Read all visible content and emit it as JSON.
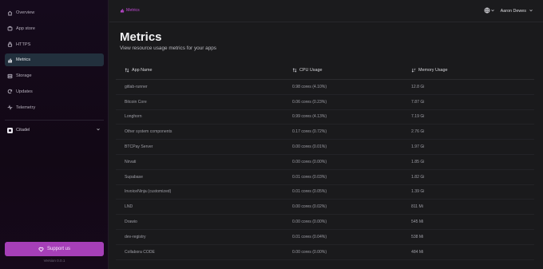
{
  "sidebar": {
    "items": [
      {
        "label": "Overview",
        "icon": "home-icon"
      },
      {
        "label": "App store",
        "icon": "store-icon"
      },
      {
        "label": "HTTPS",
        "icon": "lock-icon"
      },
      {
        "label": "Metrics",
        "icon": "bar-chart-icon",
        "active": true
      },
      {
        "label": "Storage",
        "icon": "storage-icon"
      },
      {
        "label": "Updates",
        "icon": "refresh-icon"
      },
      {
        "label": "Telemetry",
        "icon": "activity-icon"
      }
    ],
    "citadel": {
      "label": "Citadel",
      "icon": "citadel-logo"
    },
    "support_label": "Support us",
    "version": "Version 0.0.1"
  },
  "topbar": {
    "breadcrumb": "Metrics",
    "user": "Aaron Dewes"
  },
  "page": {
    "title": "Metrics",
    "subtitle": "View resource usage metrics for your apps"
  },
  "table": {
    "headers": [
      "App Name",
      "CPU Usage",
      "Memory Usage"
    ],
    "rows": [
      [
        "gitlab-runner",
        "0.98 cores (4.10%)",
        "12.8 Gi"
      ],
      [
        "Bitcoin Core",
        "0.06 cores (0.23%)",
        "7.87 Gi"
      ],
      [
        "Longhorn",
        "0.99 cores (4.13%)",
        "7.19 Gi"
      ],
      [
        "Other system components",
        "0.17 cores (0.72%)",
        "2.76 Gi"
      ],
      [
        "BTCPay Server",
        "0.00 cores (0.01%)",
        "1.97 Gi"
      ],
      [
        "Nirvati",
        "0.00 cores (0.00%)",
        "1.85 Gi"
      ],
      [
        "Supabase",
        "0.01 cores (0.03%)",
        "1.82 Gi"
      ],
      [
        "InvoiceNinja (customized)",
        "0.01 cores (0.05%)",
        "1.39 Gi"
      ],
      [
        "LND",
        "0.00 cores (0.02%)",
        "811 Mi"
      ],
      [
        "Drawio",
        "0.00 cores (0.00%)",
        "545 Mi"
      ],
      [
        "dev-registry",
        "0.01 cores (0.04%)",
        "538 Mi"
      ],
      [
        "Collabora CODE",
        "0.00 cores (0.00%)",
        "484 Mi"
      ]
    ]
  },
  "colors": {
    "accent": "#c44ad7",
    "support_button": "#a63fb8",
    "active_nav": "#22303d"
  }
}
